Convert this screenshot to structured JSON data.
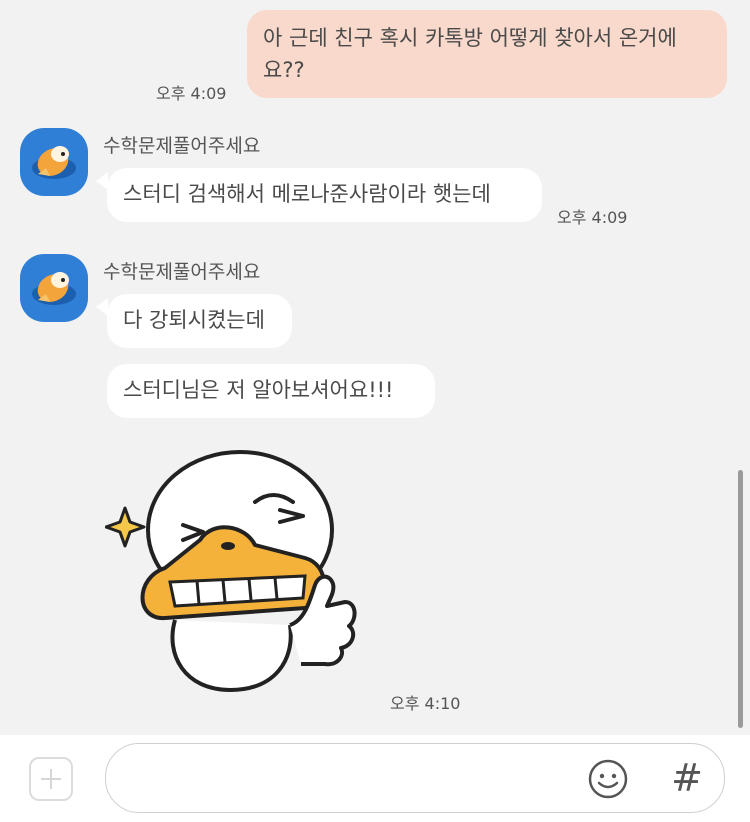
{
  "messages": [
    {
      "from": "me",
      "text": "아 근데 친구 혹시 카톡방 어떻게 찾아서 온거에요??",
      "time": "오후 4:09"
    },
    {
      "from": "other",
      "sender": "수학문제풀어주세요",
      "text": "스터디 검색해서 메로나준사람이라 햇는데",
      "time": "오후 4:09"
    },
    {
      "from": "other",
      "sender": "수학문제풀어주세요",
      "text": "다 강퇴시켰는데"
    },
    {
      "from": "other",
      "text": "스터디님은 저 알아보셔어요!!!"
    },
    {
      "from": "other",
      "type": "sticker",
      "sticker": "duck-wink-thumbs-up-sticker",
      "time": "오후 4:10"
    }
  ],
  "composer": {
    "placeholder": "",
    "add_icon": "plus-icon",
    "emoji_icon": "smiley-icon",
    "hash_label": "#"
  },
  "colors": {
    "background": "#f2f2f2",
    "my_bubble": "#f8d9cb",
    "other_bubble": "#ffffff",
    "avatar_bg": "#2f7fd6",
    "sticker_orange": "#f5b23a"
  }
}
